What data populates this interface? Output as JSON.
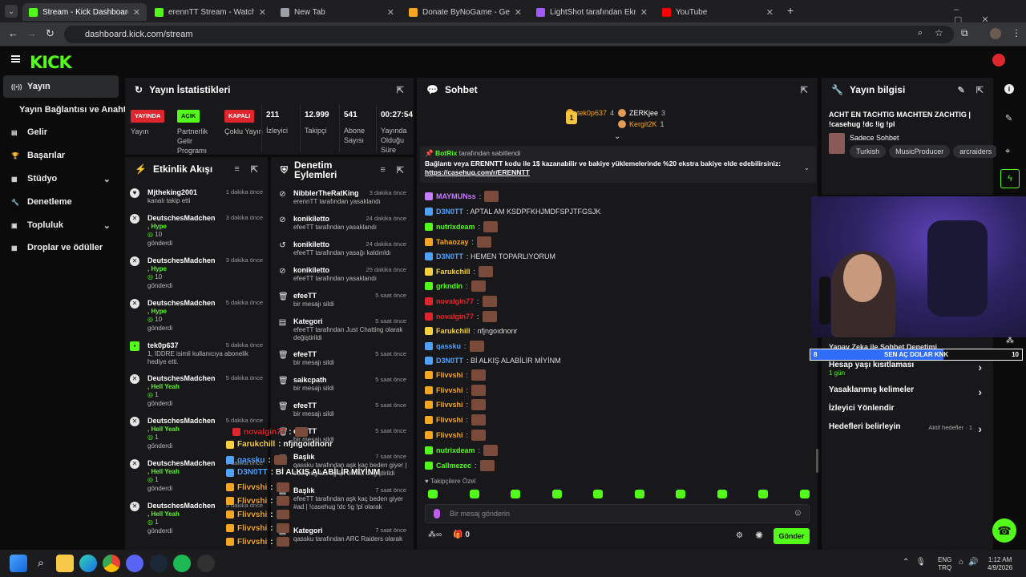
{
  "browser": {
    "tabs": [
      {
        "title": "Stream - Kick Dashboard",
        "color": "#53fc18"
      },
      {
        "title": "erennTT Stream - Watch Live o",
        "color": "#53fc18"
      },
      {
        "title": "New Tab",
        "color": "#9aa0a6"
      },
      {
        "title": "Donate ByNoGame - Gelen/Gid",
        "color": "#f5a623"
      },
      {
        "title": "LightShot tarafından Ekran Gör",
        "color": "#a259ff"
      },
      {
        "title": "YouTube",
        "color": "#ff0000"
      }
    ],
    "url": "dashboard.kick.com/stream"
  },
  "brand": {
    "logo": "KICK",
    "accent": "#53fc18"
  },
  "sidebar": {
    "items": [
      {
        "label": "Yayın",
        "icon": "broadcast-icon"
      },
      {
        "label": "Yayın Bağlantısı ve Anahtarı",
        "icon": ""
      },
      {
        "label": "Gelir",
        "icon": "revenue-icon"
      },
      {
        "label": "Başarılar",
        "icon": "trophy-icon"
      },
      {
        "label": "Stüdyo",
        "icon": "studio-icon"
      },
      {
        "label": "Denetleme",
        "icon": "wrench-icon"
      },
      {
        "label": "Topluluk",
        "icon": "community-icon"
      },
      {
        "label": "Droplar ve ödüller",
        "icon": "gift-icon"
      }
    ]
  },
  "stats": {
    "title": "Yayın İstatistikleri",
    "badges": [
      {
        "badge": "YAYINDA",
        "label": "Yayın",
        "color": "#e0262d"
      },
      {
        "badge": "AÇIK",
        "label": "Partnerlik Gelir Programı",
        "color": "#53fc18"
      },
      {
        "badge": "KAPALI",
        "label": "Çoklu Yayın",
        "color": "#e0262d"
      }
    ],
    "numbers": [
      {
        "value": "211",
        "label": "İzleyici"
      },
      {
        "value": "12.999",
        "label": "Takipçi"
      },
      {
        "value": "541",
        "label": "Abone Sayısı"
      },
      {
        "value": "00:27:54",
        "label": "Yayında Olduğu Süre"
      }
    ]
  },
  "activity": {
    "title": "Etkinlik Akışı",
    "items": [
      {
        "name": "Mjtheking2001",
        "desc": "kanalı takip etti",
        "time": "1 dakika önce"
      },
      {
        "name": "DeutschesMadchen",
        "desc": ", Hype",
        "count": "10",
        "tail": "gönderdi",
        "time": "3 dakika önce"
      },
      {
        "name": "DeutschesMadchen",
        "desc": ", Hype",
        "count": "10",
        "tail": "gönderdi",
        "time": "3 dakika önce"
      },
      {
        "name": "DeutschesMadchen",
        "desc": ", Hype",
        "count": "10",
        "tail": "gönderdi",
        "time": "5 dakika önce"
      },
      {
        "name": "tek0p637",
        "desc": "1, IDDRE isimli kullanıcıya abonelik hediye etti.",
        "time": "5 dakika önce"
      },
      {
        "name": "DeutschesMadchen",
        "desc": ", Hell Yeah",
        "count": "1",
        "tail": "gönderdi",
        "time": "5 dakika önce"
      },
      {
        "name": "DeutschesMadchen",
        "desc": ", Hell Yeah",
        "count": "1",
        "tail": "gönderdi",
        "time": "5 dakika önce"
      },
      {
        "name": "DeutschesMadchen",
        "desc": ", Hell Yeah",
        "count": "1",
        "tail": "gönderdi",
        "time": "5 dakika önce"
      },
      {
        "name": "DeutschesMadchen",
        "desc": ", Hell Yeah",
        "count": "1",
        "tail": "gönderdi",
        "time": "5 dakika önce"
      }
    ]
  },
  "moderation": {
    "title": "Denetim Eylemleri",
    "items": [
      {
        "name": "NibblerTheRatKing",
        "desc": "erennTT tarafından yasaklandı",
        "time": "3 dakika önce",
        "icon": "ban-icon"
      },
      {
        "name": "konikiletto",
        "desc": "efeeTT tarafından yasaklandı",
        "time": "24 dakika önce",
        "icon": "ban-icon"
      },
      {
        "name": "konikiletto",
        "desc": "efeeTT tarafından yasağı kaldırıldı",
        "time": "24 dakika önce",
        "icon": "undo-icon"
      },
      {
        "name": "konikiletto",
        "desc": "efeeTT tarafından yasaklandı",
        "time": "25 dakika önce",
        "icon": "ban-icon"
      },
      {
        "name": "efeeTT",
        "desc": "bir mesajı sildi",
        "time": "5 saat önce",
        "icon": "trash-icon"
      },
      {
        "name": "Kategori",
        "desc": "efeeTT tarafından Just Chatting olarak değiştirildi",
        "time": "5 saat önce",
        "icon": "category-icon"
      },
      {
        "name": "efeeTT",
        "desc": "bir mesajı sildi",
        "time": "5 saat önce",
        "icon": "trash-icon"
      },
      {
        "name": "saikcpath",
        "desc": "bir mesajı sildi",
        "time": "5 saat önce",
        "icon": "trash-icon"
      },
      {
        "name": "efeeTT",
        "desc": "bir mesajı sildi",
        "time": "5 saat önce",
        "icon": "trash-icon"
      },
      {
        "name": "efeeTT",
        "desc": "bir mesajı sildi",
        "time": "5 saat önce",
        "icon": "trash-icon"
      },
      {
        "name": "Başlık",
        "desc": "qassku tarafından aşk kaç beden giyer | casehug !dc !ig !pl olarak değiştirildi",
        "time": "7 saat önce",
        "icon": "title-icon"
      },
      {
        "name": "Başlık",
        "desc": "efeeTT tarafından aşk kaç beden giyer #ad | !casehug !dc !ig !pl olarak değiştirildi",
        "time": "7 saat önce",
        "icon": "title-icon"
      },
      {
        "name": "Kategori",
        "desc": "qassku tarafından ARC Raiders olarak",
        "time": "7 saat önce",
        "icon": "category-icon"
      }
    ]
  },
  "chat": {
    "title": "Sohbet",
    "leaders": [
      {
        "name": "tek0p637",
        "value": "4"
      },
      {
        "name": "ZERKjee",
        "value": "3"
      },
      {
        "name": "Kergit2K",
        "value": "1"
      }
    ],
    "pinned": {
      "user": "BotRix",
      "label": "tarafından sabitlendi",
      "text": "Bağlantı veya ERENNTT kodu ile 1$ kazanabilir ve bakiye yüklemelerinde %20 ekstra bakiye elde edebilirsiniz:",
      "link": "https://casehug.com/r/ERENNTT"
    },
    "messages": [
      {
        "user": "MAYMUNss",
        "color": "#c77dff",
        "text": ":",
        "emote": true
      },
      {
        "user": "D3N0TT",
        "color": "#4fa3ff",
        "text": ": APTAL AM KSDPFKHJMDFSPJTFGSJK",
        "emote": false
      },
      {
        "user": "nutrixdeam",
        "color": "#53fc18",
        "text": ":",
        "emote": true
      },
      {
        "user": "Tahaozay",
        "color": "#f5a623",
        "text": ":",
        "emote": true
      },
      {
        "user": "D3N0TT",
        "color": "#4fa3ff",
        "text": ": HEMEN TOPARLIYORUM",
        "emote": false
      },
      {
        "user": "Farukchill",
        "color": "#f5d142",
        "text": ":",
        "emote": true
      },
      {
        "user": "grkndln",
        "color": "#53fc18",
        "text": ":",
        "emote": true
      },
      {
        "user": "novalgin77",
        "color": "#e0262d",
        "text": ":",
        "emote": true
      },
      {
        "user": "novalgin77",
        "color": "#e0262d",
        "text": ":",
        "emote": true
      },
      {
        "user": "Farukchill",
        "color": "#f5d142",
        "text": ": nfjngoıdnonr",
        "emote": false
      },
      {
        "user": "qassku",
        "color": "#4fa3ff",
        "text": ":",
        "emote": true
      },
      {
        "user": "D3N0TT",
        "color": "#4fa3ff",
        "text": ": Bİ ALKIŞ ALABİLİR MİYİNM",
        "emote": false
      },
      {
        "user": "Flivvshi",
        "color": "#f5a623",
        "text": ":",
        "emote": true
      },
      {
        "user": "Flivvshi",
        "color": "#f5a623",
        "text": ":",
        "emote": true
      },
      {
        "user": "Flivvshi",
        "color": "#f5a623",
        "text": ":",
        "emote": true
      },
      {
        "user": "Flivvshi",
        "color": "#f5a623",
        "text": ":",
        "emote": true
      },
      {
        "user": "Flivvshi",
        "color": "#f5a623",
        "text": ":",
        "emote": true
      },
      {
        "user": "nutrixdeam",
        "color": "#53fc18",
        "text": ":",
        "emote": true
      },
      {
        "user": "Callmezec",
        "color": "#53fc18",
        "text": ":",
        "emote": true
      }
    ],
    "followers_only": "Takipçilere Özel",
    "placeholder": "Bir mesaj gönderin",
    "counter": "0",
    "send": "Gönder"
  },
  "stream_info": {
    "title": "Yayın bilgisi",
    "stream_title": "ACHT EN TACHTIG MACHTEN ZACHTIG | !casehug !dc !ig !pl",
    "category": "Sadece Sohbet",
    "tags": [
      "Turkish",
      "MusicProducer",
      "arcraiders"
    ],
    "section_label": "Yapay Zeka ile Sohbet Denetimi",
    "rows": [
      {
        "label": "Hesap yaşı kısıtlaması",
        "sub": "1 gün"
      },
      {
        "label": "Yasaklanmış kelimeler",
        "sub": ""
      },
      {
        "label": "İzleyici Yönlendir",
        "sub": ""
      },
      {
        "label": "Hedefleri belirleyin",
        "sub": "Aktif hedefler · 1"
      }
    ]
  },
  "goal_bar": {
    "left": "8",
    "text": "SEN AÇ DOLAR KNK",
    "right": "10",
    "progress": 0.8
  },
  "overlay_chat": [
    {
      "user": "novalgin77",
      "color": "#e0262d",
      "text": ":"
    },
    {
      "user": "Farukchill",
      "color": "#f5d142",
      "text": ": nfjngoıdnonr"
    },
    {
      "user": "qassku",
      "color": "#4fa3ff",
      "text": ":"
    },
    {
      "user": "D3N0TT",
      "color": "#4fa3ff",
      "text": ": Bİ ALKIŞ ALABİLİR MİYİNM"
    },
    {
      "user": "Flivvshi",
      "color": "#f5a623",
      "text": ":"
    },
    {
      "user": "Flivvshi",
      "color": "#f5a623",
      "text": ":"
    },
    {
      "user": "Flivvshi",
      "color": "#f5a623",
      "text": ":"
    },
    {
      "user": "Flivvshi",
      "color": "#f5a623",
      "text": ":"
    },
    {
      "user": "Flivvshi",
      "color": "#f5a623",
      "text": ":"
    },
    {
      "user": "nutrixdeam",
      "color": "#53fc18",
      "text": ":"
    }
  ],
  "taskbar": {
    "lang": "ENG",
    "region": "TRQ",
    "time": "1:12 AM",
    "date": "4/9/2026"
  }
}
